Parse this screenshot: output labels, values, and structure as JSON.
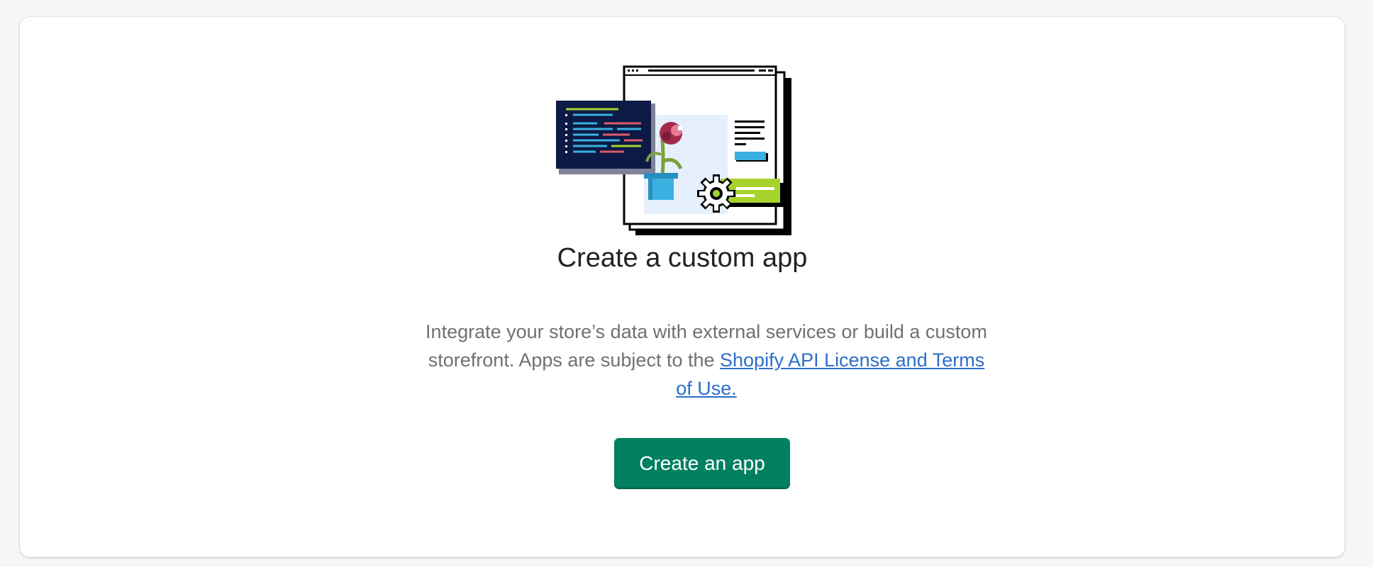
{
  "card": {
    "illustration_icon": "custom-app-illustration-icon",
    "title": "Create a custom app",
    "description_text": "Integrate your store’s data with external services or build a custom storefront. Apps are subject to the ",
    "link_text": "Shopify API License and Terms of Use.",
    "button_label": "Create an app"
  },
  "colors": {
    "primary_button": "#008060",
    "link": "#2c6ecb",
    "title": "#202223",
    "body_text": "#6d7175",
    "background": "#f6f6f7"
  }
}
